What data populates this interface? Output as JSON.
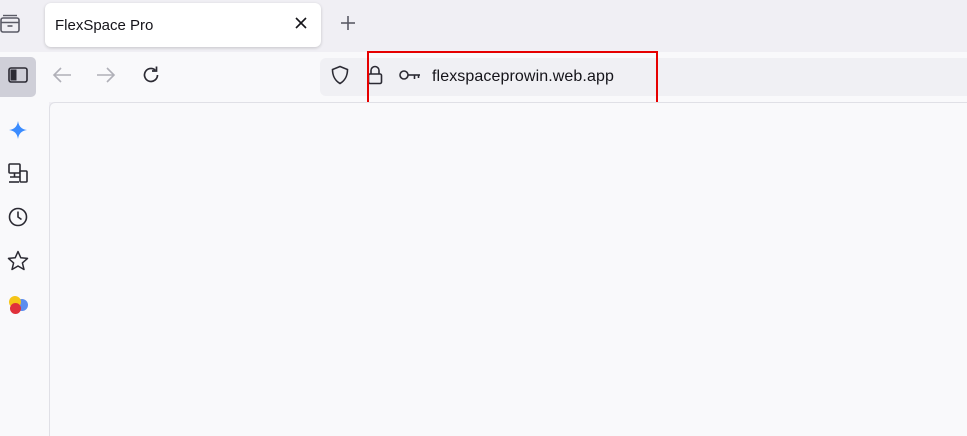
{
  "tab": {
    "title": "FlexSpace Pro",
    "close_icon": "close-icon"
  },
  "tabbar": {
    "list_icon": "tab-list-icon",
    "new_tab_icon": "plus-icon"
  },
  "navigation": {
    "sidebar_icon": "sidebar-icon",
    "back_icon": "arrow-left-icon",
    "forward_icon": "arrow-right-icon",
    "reload_icon": "reload-icon"
  },
  "urlbar": {
    "url": "flexspaceprowin.web.app",
    "icons": [
      "shield-icon",
      "lock-icon",
      "key-icon"
    ]
  },
  "sidebar": {
    "items": [
      "sparkle-ai-icon",
      "synced-devices-icon",
      "history-icon",
      "bookmark-star-icon",
      "extension-icon"
    ]
  },
  "colors": {
    "highlight_box": "#e60000",
    "ai_sparkle": "#3b8cff",
    "sidebar_active_bg": "#cfcfd8"
  }
}
